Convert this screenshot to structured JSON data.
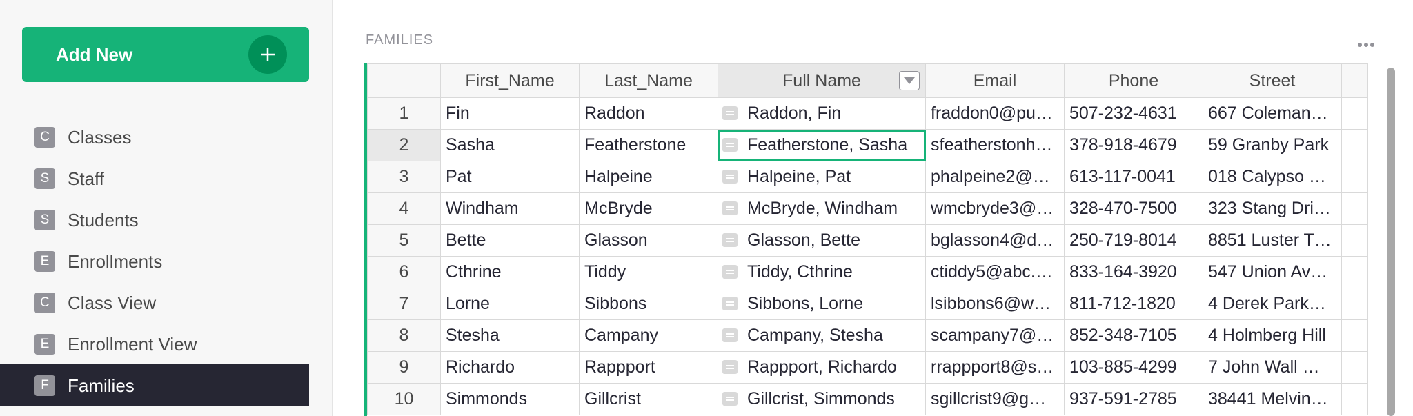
{
  "sidebar": {
    "add_new_label": "Add New",
    "items": [
      {
        "badge": "C",
        "label": "Classes",
        "active": false
      },
      {
        "badge": "S",
        "label": "Staff",
        "active": false
      },
      {
        "badge": "S",
        "label": "Students",
        "active": false
      },
      {
        "badge": "E",
        "label": "Enrollments",
        "active": false
      },
      {
        "badge": "C",
        "label": "Class View",
        "active": false
      },
      {
        "badge": "E",
        "label": "Enrollment View",
        "active": false
      },
      {
        "badge": "F",
        "label": "Families",
        "active": true
      }
    ]
  },
  "main": {
    "section_title": "FAMILIES",
    "columns": [
      "First_Name",
      "Last_Name",
      "Full Name",
      "Email",
      "Phone",
      "Street"
    ],
    "selected_column": "Full Name",
    "cursor_row": 2,
    "rows": [
      {
        "num": "1",
        "first": "Fin",
        "last": "Raddon",
        "full": "Raddon, Fin",
        "email": "fraddon0@pu…",
        "phone": "507-232-4631",
        "street": "667 Coleman…"
      },
      {
        "num": "2",
        "first": "Sasha",
        "last": "Featherstone",
        "full": "Featherstone, Sasha",
        "email": "sfeatherstonh…",
        "phone": "378-918-4679",
        "street": "59 Granby Park"
      },
      {
        "num": "3",
        "first": "Pat",
        "last": "Halpeine",
        "full": "Halpeine, Pat",
        "email": "phalpeine2@…",
        "phone": "613-117-0041",
        "street": "018 Calypso …"
      },
      {
        "num": "4",
        "first": "Windham",
        "last": "McBryde",
        "full": "McBryde, Windham",
        "email": "wmcbryde3@…",
        "phone": "328-470-7500",
        "street": "323 Stang Dri…"
      },
      {
        "num": "5",
        "first": "Bette",
        "last": "Glasson",
        "full": "Glasson, Bette",
        "email": "bglasson4@d…",
        "phone": "250-719-8014",
        "street": "8851 Luster T…"
      },
      {
        "num": "6",
        "first": "Cthrine",
        "last": "Tiddy",
        "full": "Tiddy, Cthrine",
        "email": "ctiddy5@abc.…",
        "phone": "833-164-3920",
        "street": "547 Union Av…"
      },
      {
        "num": "7",
        "first": "Lorne",
        "last": "Sibbons",
        "full": "Sibbons, Lorne",
        "email": "lsibbons6@w…",
        "phone": "811-712-1820",
        "street": "4 Derek Park…"
      },
      {
        "num": "8",
        "first": "Stesha",
        "last": "Campany",
        "full": "Campany, Stesha",
        "email": "scampany7@…",
        "phone": "852-348-7105",
        "street": "4 Holmberg Hill"
      },
      {
        "num": "9",
        "first": "Richardo",
        "last": "Rappport",
        "full": "Rappport, Richardo",
        "email": "rrappport8@s…",
        "phone": "103-885-4299",
        "street": "7 John Wall …"
      },
      {
        "num": "10",
        "first": "Simmonds",
        "last": "Gillcrist",
        "full": "Gillcrist, Simmonds",
        "email": "sgillcrist9@g…",
        "phone": "937-591-2785",
        "street": "38441 Melvin…"
      }
    ]
  },
  "colors": {
    "accent": "#16b378",
    "accent_dark": "#009058",
    "active_nav": "#262633"
  }
}
